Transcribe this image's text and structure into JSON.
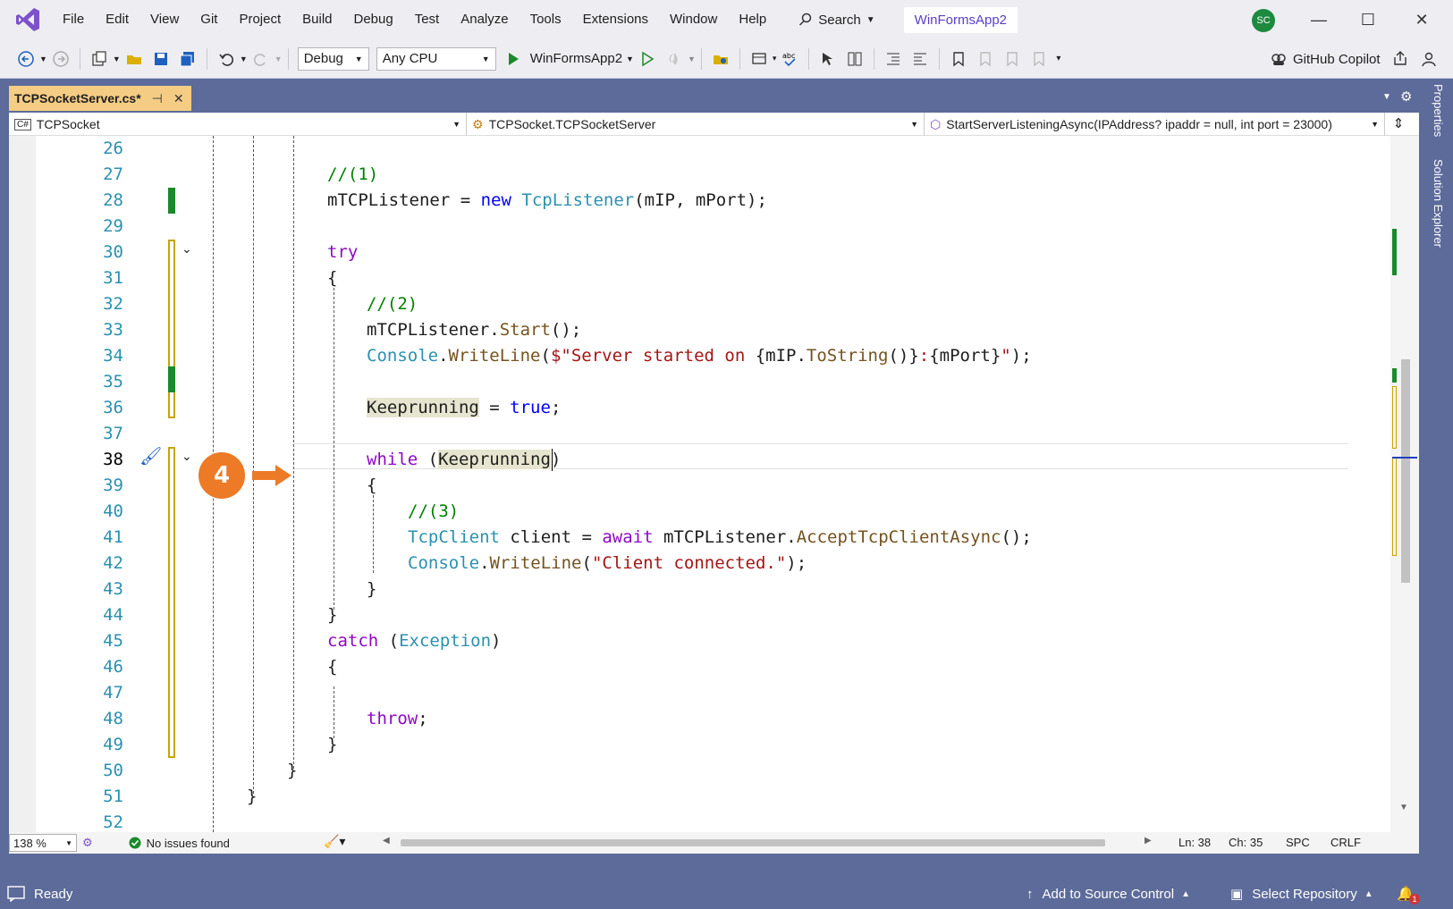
{
  "menu": [
    "File",
    "Edit",
    "View",
    "Git",
    "Project",
    "Build",
    "Debug",
    "Test",
    "Analyze",
    "Tools",
    "Extensions",
    "Window",
    "Help"
  ],
  "search_label": "Search",
  "solution_name": "WinFormsApp2",
  "avatar_initials": "SC",
  "toolbar": {
    "config": "Debug",
    "platform": "Any CPU",
    "run_target": "WinFormsApp2",
    "copilot": "GitHub Copilot"
  },
  "tab": {
    "title": "TCPSocketServer.cs*"
  },
  "side_tabs": [
    "Properties",
    "Solution Explorer"
  ],
  "nav": {
    "project": "TCPSocket",
    "type": "TCPSocket.TCPSocketServer",
    "member": "StartServerListeningAsync(IPAddress? ipaddr = null, int port = 23000)"
  },
  "line_numbers": [
    "26",
    "27",
    "28",
    "29",
    "30",
    "31",
    "32",
    "33",
    "34",
    "35",
    "36",
    "37",
    "38",
    "39",
    "40",
    "41",
    "42",
    "43",
    "44",
    "45",
    "46",
    "47",
    "48",
    "49",
    "50",
    "51",
    "52"
  ],
  "code": {
    "l27": "//(1)",
    "l28_a": "mTCPListener = ",
    "l28_new": "new",
    "l28_type": "TcpListener",
    "l28_b": "(mIP, mPort);",
    "l30": "try",
    "l31": "{",
    "l32": "//(2)",
    "l33_a": "mTCPListener.",
    "l33_m": "Start",
    "l33_b": "();",
    "l34_type": "Console",
    "l34_dot": ".",
    "l34_m": "WriteLine",
    "l34_a": "(",
    "l34_str1": "$\"Server started on ",
    "l34_b": "{mIP.",
    "l34_m2": "ToString",
    "l34_c": "()}",
    "l34_str2": ":",
    "l34_d": "{mPort}",
    "l34_str3": "\"",
    "l34_e": ");",
    "l36_var": "Keeprunning",
    "l36_a": " = ",
    "l36_true": "true",
    "l36_b": ";",
    "l38_while": "while",
    "l38_a": " (",
    "l38_var": "Keeprunning",
    "l38_b": ")",
    "l39": "{",
    "l40": "//(3)",
    "l41_type": "TcpClient",
    "l41_a": " client = ",
    "l41_await": "await",
    "l41_b": " mTCPListener.",
    "l41_m": "AcceptTcpClientAsync",
    "l41_c": "();",
    "l42_type": "Console",
    "l42_dot": ".",
    "l42_m": "WriteLine",
    "l42_a": "(",
    "l42_str": "\"Client connected.\"",
    "l42_b": ");",
    "l43": "}",
    "l44": "}",
    "l45_catch": "catch",
    "l45_a": " (",
    "l45_type": "Exception",
    "l45_b": ")",
    "l46": "{",
    "l48_throw": "throw",
    "l48_a": ";",
    "l49": "}",
    "l50": "}",
    "l51": "}"
  },
  "callout_number": "4",
  "editor_status": {
    "zoom": "138 %",
    "issues": "No issues found",
    "ln": "Ln: 38",
    "ch": "Ch: 35",
    "spc": "SPC",
    "eol": "CRLF"
  },
  "statusbar": {
    "ready": "Ready",
    "source_control": "Add to Source Control",
    "repository": "Select Repository",
    "notifications": "1"
  },
  "colors": {
    "accent": "#5b3ec8",
    "chrome": "#eeeef2",
    "well": "#5c6b99",
    "tab_active": "#f5cc84",
    "callout": "#ec7a27"
  }
}
